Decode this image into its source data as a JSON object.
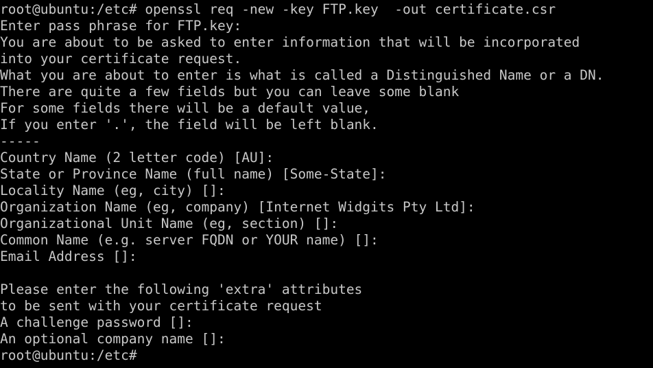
{
  "terminal": {
    "background": "#000000",
    "foreground": "#c8c8c8",
    "lines": [
      "root@ubuntu:/etc# openssl req -new -key FTP.key  -out certificate.csr",
      "Enter pass phrase for FTP.key:",
      "You are about to be asked to enter information that will be incorporated",
      "into your certificate request.",
      "What you are about to enter is what is called a Distinguished Name or a DN.",
      "There are quite a few fields but you can leave some blank",
      "For some fields there will be a default value,",
      "If you enter '.', the field will be left blank.",
      "-----",
      "Country Name (2 letter code) [AU]:",
      "State or Province Name (full name) [Some-State]:",
      "Locality Name (eg, city) []:",
      "Organization Name (eg, company) [Internet Widgits Pty Ltd]:",
      "Organizational Unit Name (eg, section) []:",
      "Common Name (e.g. server FQDN or YOUR name) []:",
      "Email Address []:",
      "",
      "Please enter the following 'extra' attributes",
      "to be sent with your certificate request",
      "A challenge password []:",
      "An optional company name []:",
      "root@ubuntu:/etc#"
    ]
  }
}
